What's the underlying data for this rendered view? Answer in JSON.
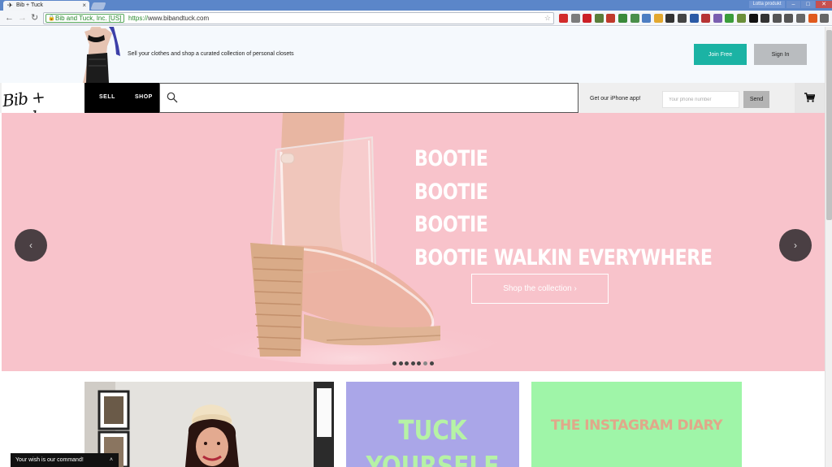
{
  "browser": {
    "tab_title": "Bib + Tuck",
    "user_label": "Lotta produkt",
    "ev_badge": "Bib and Tuck, Inc. [US]",
    "url_scheme": "https://",
    "url_host": "www.bibandtuck.com",
    "extensions": [
      {
        "name": "heart-icon",
        "color": "#d22b2b"
      },
      {
        "name": "scale-icon",
        "color": "#7c7c7c"
      },
      {
        "name": "pinterest-icon",
        "color": "#cb2027"
      },
      {
        "name": "dropper-icon",
        "color": "#5a7d3a"
      },
      {
        "name": "record-icon",
        "color": "#c0392b"
      },
      {
        "name": "pb-icon",
        "color": "#3a8a3a"
      },
      {
        "name": "recycle-icon",
        "color": "#4a8f4a"
      },
      {
        "name": "screen-icon",
        "color": "#4d7ec2"
      },
      {
        "name": "smile-icon",
        "color": "#e3a82f"
      },
      {
        "name": "circle-icon",
        "color": "#333333"
      },
      {
        "name": "m-icon",
        "color": "#444444"
      },
      {
        "name": "grid-icon",
        "color": "#2b5aa6"
      },
      {
        "name": "hat-icon",
        "color": "#b63434"
      },
      {
        "name": "dots-icon",
        "color": "#7a5fb0"
      },
      {
        "name": "green-icon",
        "color": "#3a9d3a"
      },
      {
        "name": "photo-icon",
        "color": "#6b8f3a"
      },
      {
        "name": "black-icon",
        "color": "#111111"
      },
      {
        "name": "layers-icon",
        "color": "#333333"
      },
      {
        "name": "pen-icon",
        "color": "#555555"
      },
      {
        "name": "pocket-icon",
        "color": "#555555"
      },
      {
        "name": "mail-icon",
        "color": "#666666"
      },
      {
        "name": "abp-icon",
        "color": "#e05a1e"
      },
      {
        "name": "menu-icon",
        "color": "#666666"
      }
    ]
  },
  "promo": {
    "tagline": "Sell your clothes and shop a curated collection of personal closets",
    "join_label": "Join Free",
    "signin_label": "Sign In"
  },
  "nav": {
    "logo_text": "Bib + Tuck",
    "sell_label": "SELL",
    "shop_label": "SHOP",
    "search_placeholder": "",
    "app_label": "Get our iPhone app!",
    "phone_placeholder": "Your phone number",
    "send_label": "Send"
  },
  "hero": {
    "headline": [
      "BOOTIE",
      "BOOTIE",
      "BOOTIE",
      "BOOTIE WALKIN EVERYWHERE"
    ],
    "cta_label": "Shop the collection  ›",
    "prev_glyph": "‹",
    "next_glyph": "›",
    "dots_count": 7,
    "active_dot": 5
  },
  "tiles": {
    "tuck_line1": "TUCK",
    "tuck_line2": "YOURSELF",
    "instagram": "THE INSTAGRAM DIARY"
  },
  "chat": {
    "label": "Your wish is our command!",
    "chevron": "˄"
  },
  "colors": {
    "hero_bg": "#f8c3cb",
    "join_bg": "#1bb3a4",
    "tile_purple": "#aaa6e8",
    "tile_green": "#9ff5a8"
  }
}
